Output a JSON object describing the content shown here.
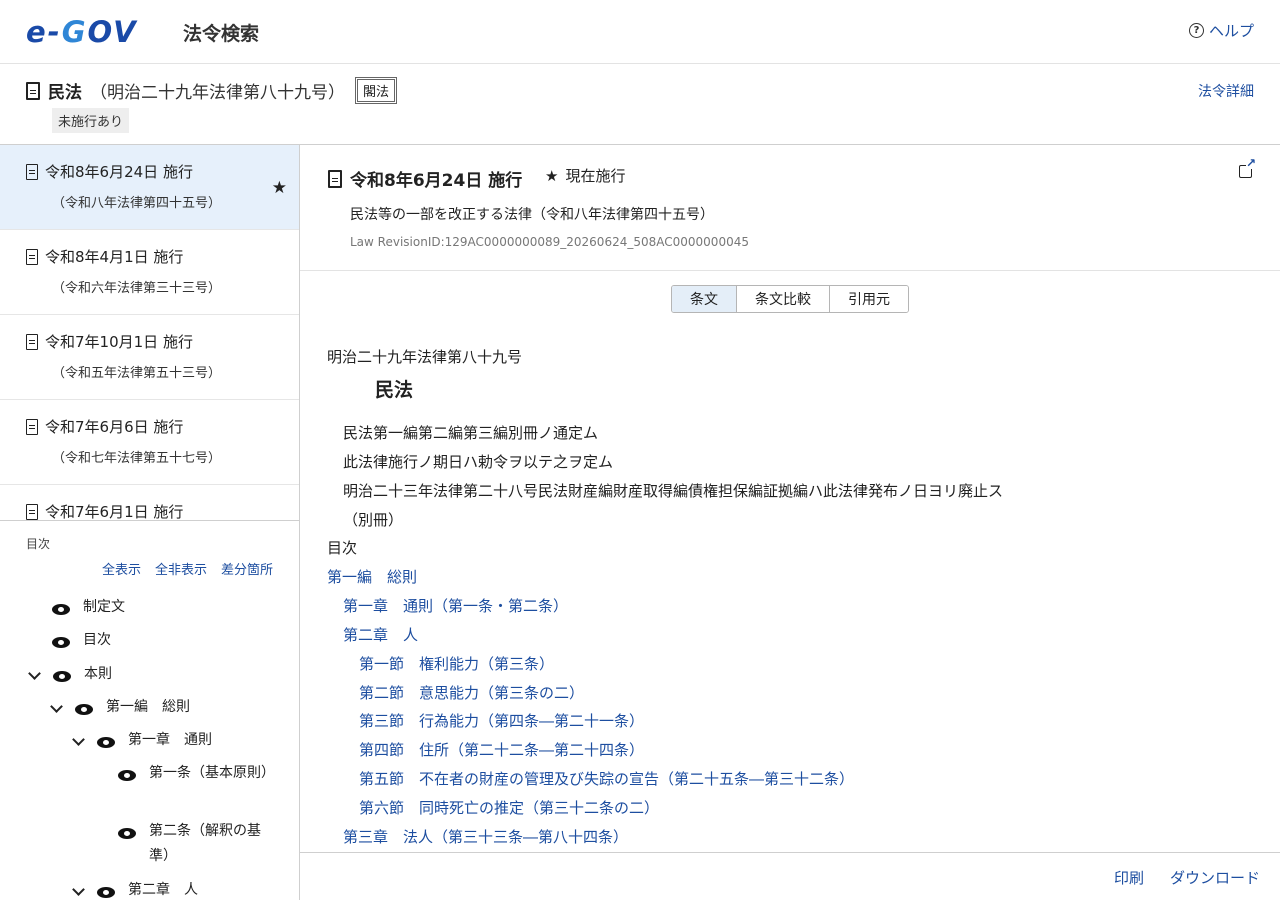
{
  "header": {
    "logo_text_e": "e-",
    "logo_text_g": "G",
    "logo_text_ov": "OV",
    "site_title": "法令検索",
    "help_label": "ヘルプ"
  },
  "law": {
    "name": "民法",
    "number": "（明治二十九年法律第八十九号）",
    "type_badge": "閣法",
    "unenforced_badge": "未施行あり",
    "detail_link": "法令詳細"
  },
  "revisions": [
    {
      "date": "令和8年6月24日 施行",
      "law": "（令和八年法律第四十五号）",
      "active": true
    },
    {
      "date": "令和8年4月1日 施行",
      "law": "（令和六年法律第三十三号）",
      "active": false
    },
    {
      "date": "令和7年10月1日 施行",
      "law": "（令和五年法律第五十三号）",
      "active": false
    },
    {
      "date": "令和7年6月6日 施行",
      "law": "（令和七年法律第五十七号）",
      "active": false
    },
    {
      "date": "令和7年6月1日 施行",
      "law": "",
      "active": false
    }
  ],
  "toc": {
    "label": "目次",
    "show_all": "全表示",
    "hide_all": "全非表示",
    "diff": "差分箇所",
    "items": [
      {
        "label": "制定文"
      },
      {
        "label": "目次"
      },
      {
        "label": "本則"
      },
      {
        "label": "第一編　総則"
      },
      {
        "label": "第一章　通則"
      },
      {
        "label": "第一条（基本原則）"
      },
      {
        "label": "第二条（解釈の基準）"
      },
      {
        "label": "第二章　人"
      }
    ]
  },
  "revision_header": {
    "date": "令和8年6月24日 施行",
    "current": "現在施行",
    "amending_law": "民法等の一部を改正する法律（令和八年法律第四十五号）",
    "revision_id": "Law RevisionID:129AC0000000089_20260624_508AC0000000045"
  },
  "tabs": [
    "条文",
    "条文比較",
    "引用元"
  ],
  "content": {
    "law_number": "明治二十九年法律第八十九号",
    "title": "民法",
    "preamble": [
      "民法第一編第二編第三編別冊ノ通定ム",
      "此法律施行ノ期日ハ勅令ヲ以テ之ヲ定ム",
      "明治二十三年法律第二十八号民法財産編財産取得編債権担保編証拠編ハ此法律発布ノ日ヨリ廃止ス",
      "（別冊）"
    ],
    "toc_heading": "目次",
    "toc_links": [
      "第一編　総則",
      "第一章　通則（第一条・第二条）",
      "第二章　人",
      "第一節　権利能力（第三条）",
      "第二節　意思能力（第三条の二）",
      "第三節　行為能力（第四条―第二十一条）",
      "第四節　住所（第二十二条―第二十四条）",
      "第五節　不在者の財産の管理及び失踪の宣告（第二十五条―第三十二条）",
      "第六節　同時死亡の推定（第三十二条の二）",
      "第三章　法人（第三十三条―第八十四条）"
    ]
  },
  "footer": {
    "print": "印刷",
    "download": "ダウンロード"
  },
  "colors": {
    "link": "#1d4ea0",
    "active_bg": "#e6f0fb",
    "logo_blue": "#1a4aa8"
  }
}
